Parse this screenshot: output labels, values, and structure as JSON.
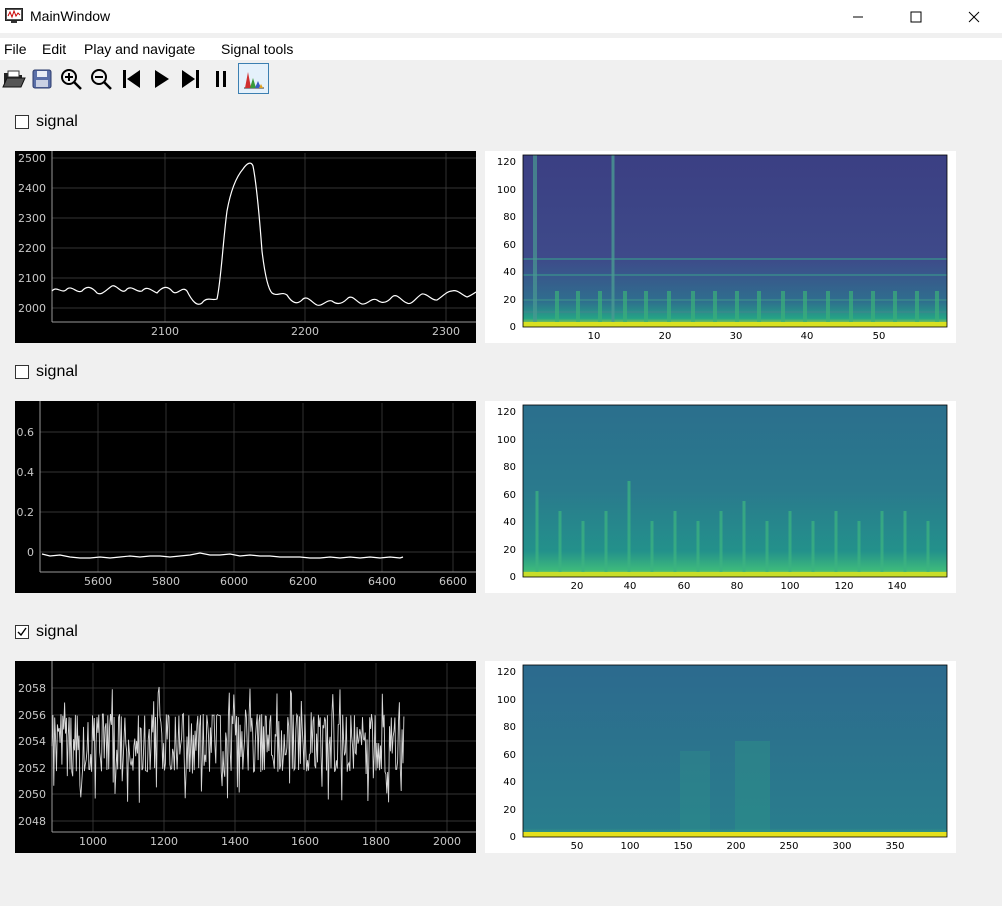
{
  "window": {
    "title": "MainWindow"
  },
  "menu": {
    "items": [
      "File",
      "Edit",
      "Play and navigate",
      "Signal tools"
    ]
  },
  "toolbar": {
    "buttons": [
      "open-icon",
      "save-icon",
      "zoom-in-icon",
      "zoom-out-icon",
      "skip-back-icon",
      "play-icon",
      "skip-forward-icon",
      "pause-icon",
      "spectrogram-icon"
    ]
  },
  "signals": [
    {
      "label": "signal",
      "checked": false,
      "plot": {
        "x_ticks": [
          "2100",
          "2200",
          "2300"
        ],
        "y_ticks": [
          "2500",
          "2400",
          "2300",
          "2200",
          "2100",
          "2000"
        ]
      },
      "spectrogram": {
        "x_ticks": [
          "10",
          "20",
          "30",
          "40",
          "50"
        ],
        "y_ticks": [
          "120",
          "100",
          "80",
          "60",
          "40",
          "20",
          "0"
        ]
      }
    },
    {
      "label": "signal",
      "checked": false,
      "plot": {
        "x_ticks": [
          "5600",
          "5800",
          "6000",
          "6200",
          "6400",
          "6600"
        ],
        "y_ticks": [
          "0.6",
          "0.4",
          "0.2",
          "0"
        ]
      },
      "spectrogram": {
        "x_ticks": [
          "20",
          "40",
          "60",
          "80",
          "100",
          "120",
          "140"
        ],
        "y_ticks": [
          "120",
          "100",
          "80",
          "60",
          "40",
          "20",
          "0"
        ]
      }
    },
    {
      "label": "signal",
      "checked": true,
      "plot": {
        "x_ticks": [
          "1000",
          "1200",
          "1400",
          "1600",
          "1800",
          "2000"
        ],
        "y_ticks": [
          "2058",
          "2056",
          "2054",
          "2052",
          "2050",
          "2048"
        ]
      },
      "spectrogram": {
        "x_ticks": [
          "50",
          "100",
          "150",
          "200",
          "250",
          "300",
          "350"
        ],
        "y_ticks": [
          "120",
          "100",
          "80",
          "60",
          "40",
          "20",
          "0"
        ]
      }
    }
  ]
}
